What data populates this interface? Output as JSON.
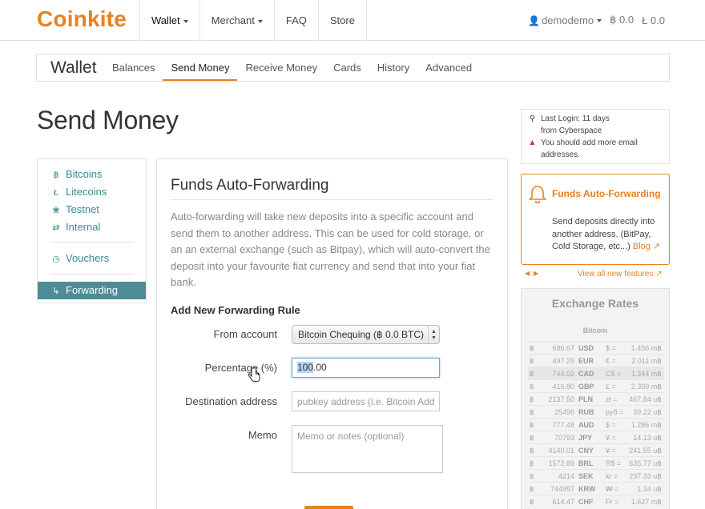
{
  "brand": "Coinkite",
  "topnav": {
    "items": [
      "Wallet",
      "Merchant",
      "FAQ",
      "Store"
    ],
    "user": "demodemo",
    "btc_balance": "฿ 0.0",
    "ltc_balance": "Ł 0.0"
  },
  "subnav": {
    "title": "Wallet",
    "items": [
      "Balances",
      "Send Money",
      "Receive Money",
      "Cards",
      "History",
      "Advanced"
    ],
    "active": "Send Money"
  },
  "page_title": "Send Money",
  "sidenav": {
    "items": [
      {
        "label": "Bitcoins",
        "icon": "bitcoin-icon",
        "glyph": "฿"
      },
      {
        "label": "Litecoins",
        "icon": "litecoin-icon",
        "glyph": "Ł"
      },
      {
        "label": "Testnet",
        "icon": "testnet-icon",
        "glyph": "❀"
      },
      {
        "label": "Internal",
        "icon": "transfer-icon",
        "glyph": "⇄"
      },
      {
        "label": "Vouchers",
        "icon": "clock-icon",
        "glyph": "◷"
      },
      {
        "label": "Forwarding",
        "icon": "forward-icon",
        "glyph": "↳"
      }
    ],
    "active": "Forwarding"
  },
  "panel": {
    "title": "Funds Auto-Forwarding",
    "description": "Auto-forwarding will take new deposits into a specific account and send them to another address. This can be used for cold storage, or an an external exchange (such as Bitpay), which will auto-convert the deposit into your favourite fiat currency and send that into your fiat bank.",
    "rule_heading": "Add New Forwarding Rule",
    "from_account_label": "From account",
    "from_account_value": "Bitcoin Chequing (฿ 0.0 BTC)",
    "percentage_label": "Percentage (%)",
    "percentage_value_selected": "100",
    "percentage_value_rest": ".00",
    "destination_label": "Destination address",
    "destination_placeholder": "pubkey address (i.e. Bitcoin Address)",
    "memo_label": "Memo",
    "memo_placeholder": "Memo or notes (optional)"
  },
  "login": {
    "line1": "Last Login: 11 days",
    "line2": "from Cyberspace",
    "line3": "You should add more email",
    "line4": "addresses."
  },
  "promo": {
    "title": "Funds Auto-Forwarding",
    "text": "Send deposits directly into another address. (BitPay, Cold Storage, etc...)",
    "link": "Blog"
  },
  "view_all": "View all new features",
  "rates": {
    "title": "Exchange Rates",
    "subtitle": "Bitcoin",
    "rows": [
      {
        "value": "686.67",
        "cur": "USD",
        "sym": "$",
        "price": "1.456 m฿"
      },
      {
        "value": "497.29",
        "cur": "EUR",
        "sym": "€",
        "price": "2.011 m฿"
      },
      {
        "value": "744.02",
        "cur": "CAD",
        "sym": "C$",
        "price": "1.344 m฿"
      },
      {
        "value": "416.80",
        "cur": "GBP",
        "sym": "£",
        "price": "2.399 m฿"
      },
      {
        "value": "2137.50",
        "cur": "PLN",
        "sym": "zł",
        "price": "467.84 u฿"
      },
      {
        "value": "25496",
        "cur": "RUB",
        "sym": "руб",
        "price": "39.22 u฿"
      },
      {
        "value": "777.48",
        "cur": "AUD",
        "sym": "$",
        "price": "1.286 m฿"
      },
      {
        "value": "70793",
        "cur": "JPY",
        "sym": "¥",
        "price": "14.13 u฿"
      },
      {
        "value": "4140.01",
        "cur": "CNY",
        "sym": "¥",
        "price": "241.55 u฿"
      },
      {
        "value": "1572.89",
        "cur": "BRL",
        "sym": "R$",
        "price": "635.77 u฿"
      },
      {
        "value": "4214",
        "cur": "SEK",
        "sym": "kr",
        "price": "237.33 u฿"
      },
      {
        "value": "744997",
        "cur": "KRW",
        "sym": "₩",
        "price": "1.34 u฿"
      },
      {
        "value": "614.47",
        "cur": "CHF",
        "sym": "Fr",
        "price": "1.627 m฿"
      }
    ]
  },
  "colors": {
    "brand": "#e8811f",
    "teal": "#4d8d96"
  }
}
